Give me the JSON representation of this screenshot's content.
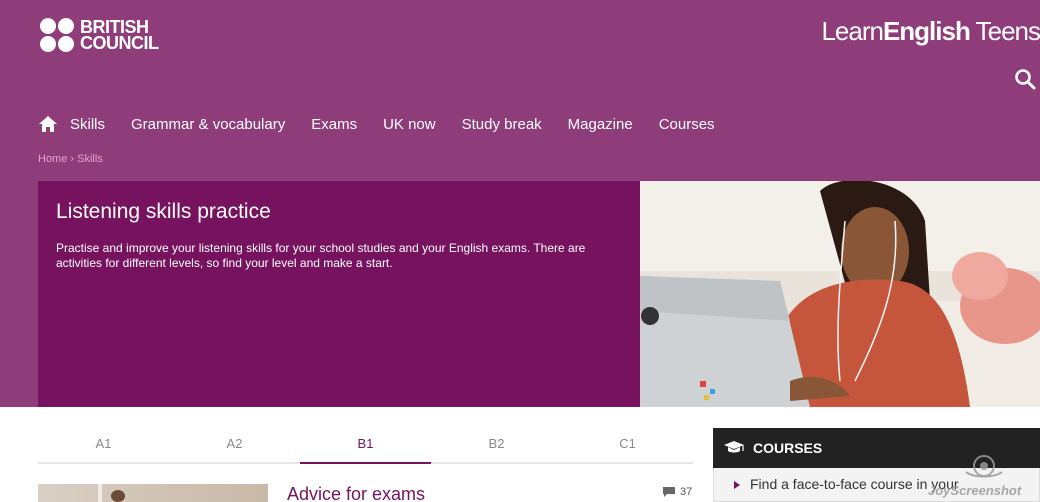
{
  "brand": {
    "logo_line1": "BRITISH",
    "logo_line2": "COUNCIL",
    "site_learn": "Learn",
    "site_english": "English",
    "site_teens": " Teens"
  },
  "nav": {
    "items": [
      "Skills",
      "Grammar & vocabulary",
      "Exams",
      "UK now",
      "Study break",
      "Magazine",
      "Courses"
    ]
  },
  "breadcrumb": {
    "home": "Home",
    "separator": " › ",
    "current": "Skills"
  },
  "hero": {
    "title": "Listening skills practice",
    "description": "Practise and improve your listening skills for your school studies and your English exams. There are activities for different levels, so find your level and make a start."
  },
  "levels": {
    "tabs": [
      "A1",
      "A2",
      "B1",
      "B2",
      "C1"
    ],
    "active": "B1"
  },
  "article": {
    "title": "Advice for exams",
    "comments": "37"
  },
  "courses": {
    "heading": "COURSES",
    "link": "Find a face-to-face course in your"
  },
  "watermark": "JoyScreenshot",
  "colors": {
    "header_bg": "#8f3c7a",
    "hero_bg": "#77125f",
    "accent": "#77125f",
    "courses_head_bg": "#222222"
  },
  "icons": [
    "home-icon",
    "search-icon",
    "graduation-cap-icon",
    "comment-icon"
  ]
}
